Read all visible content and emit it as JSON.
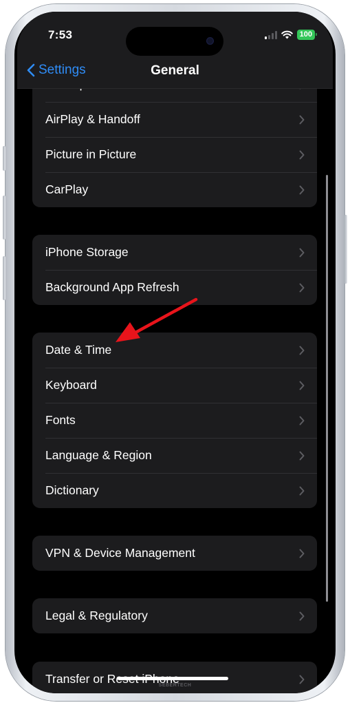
{
  "status_bar": {
    "time": "7:53",
    "battery_level": "100",
    "battery_color": "#34c759",
    "icons": [
      "cellular-signal-icon",
      "wifi-icon",
      "battery-icon"
    ]
  },
  "nav": {
    "back_label": "Settings",
    "title": "General",
    "accent_color": "#2f8cf6"
  },
  "groups": [
    {
      "items": [
        {
          "label": "AirDrop"
        },
        {
          "label": "AirPlay & Handoff"
        },
        {
          "label": "Picture in Picture"
        },
        {
          "label": "CarPlay"
        }
      ]
    },
    {
      "items": [
        {
          "label": "iPhone Storage"
        },
        {
          "label": "Background App Refresh"
        }
      ]
    },
    {
      "items": [
        {
          "label": "Date & Time"
        },
        {
          "label": "Keyboard"
        },
        {
          "label": "Fonts"
        },
        {
          "label": "Language & Region"
        },
        {
          "label": "Dictionary"
        }
      ]
    },
    {
      "items": [
        {
          "label": "VPN & Device Management"
        }
      ]
    },
    {
      "items": [
        {
          "label": "Legal & Regulatory"
        }
      ]
    },
    {
      "items": [
        {
          "label": "Transfer or Reset iPhone"
        }
      ]
    }
  ],
  "annotation": {
    "type": "red-arrow",
    "points_to": "Date & Time",
    "color": "#e8141b"
  },
  "watermark": "SEBERTECH"
}
